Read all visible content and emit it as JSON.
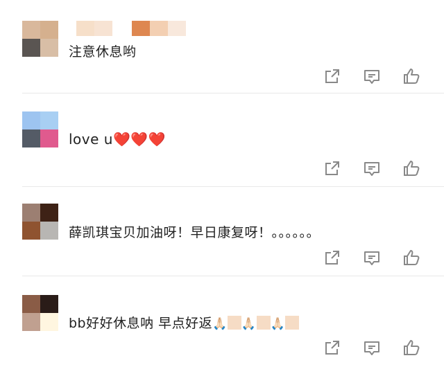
{
  "comments": [
    {
      "text": "注意休息哟",
      "avatar_colors": [
        "#d9b89c",
        "#d5b08e",
        "#5a5552",
        "#d8bea6"
      ],
      "username_colors": [
        "#f6dfc9",
        "#f7e3d3",
        "#ffffff",
        "#de8750",
        "#f3cfb2",
        "#f8e8dc"
      ]
    },
    {
      "text": "love u",
      "hearts": [
        "❤️",
        "❤️",
        "❤️"
      ],
      "avatar_colors": [
        "#9dc4f0",
        "#a8cff3",
        "#545b66",
        "#e05a8e"
      ]
    },
    {
      "text": "薛凯琪宝贝加油呀！早日康复呀！。。。。。。",
      "avatar_colors": [
        "#9c7f72",
        "#3e2216",
        "#8f5330",
        "#b8b6b3"
      ]
    },
    {
      "text": "bb好好休息呐 早点好返",
      "pray_emoji": "🙏🏻",
      "avatar_colors": [
        "#8a5c46",
        "#2a1c18",
        "#c0a090",
        "#fff6e0"
      ],
      "tile_color": "#f6dcc5"
    }
  ],
  "icons": [
    "share-icon",
    "comment-icon",
    "like-icon"
  ]
}
